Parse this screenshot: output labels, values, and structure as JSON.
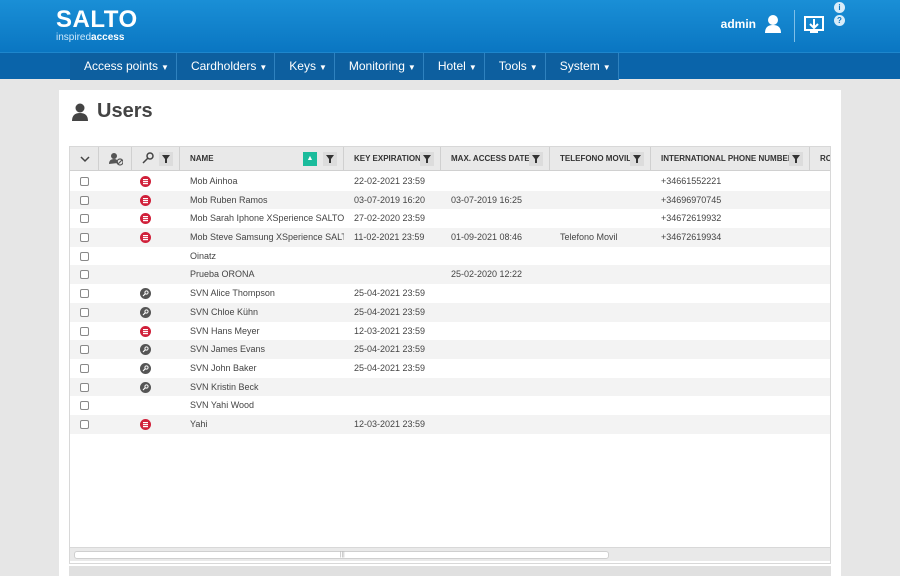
{
  "header": {
    "logo": "SALTO",
    "logo_sub_a": "inspired",
    "logo_sub_b": "access",
    "user": "admin",
    "help_1": "i",
    "help_2": "?"
  },
  "nav": [
    {
      "label": "Access points"
    },
    {
      "label": "Cardholders"
    },
    {
      "label": "Keys"
    },
    {
      "label": "Monitoring"
    },
    {
      "label": "Hotel"
    },
    {
      "label": "Tools"
    },
    {
      "label": "System"
    }
  ],
  "page": {
    "title": "Users"
  },
  "table": {
    "columns": {
      "name": "NAME",
      "key_expiration": "KEY EXPIRATION",
      "max_access_date": "MAX. ACCESS DATE",
      "telefono_movil": "TELEFONO MOVIL",
      "intl_phone": "INTERNATIONAL PHONE NUMBER",
      "extra": "ROI"
    },
    "rows": [
      {
        "icon": "mobile",
        "name": "Mob Ainhoa",
        "key_exp": "22-02-2021 23:59",
        "max_access": "",
        "tel": "",
        "intl": "+34661552221"
      },
      {
        "icon": "mobile",
        "name": "Mob Ruben Ramos",
        "key_exp": "03-07-2019 16:20",
        "max_access": "03-07-2019 16:25",
        "tel": "",
        "intl": "+34696970745"
      },
      {
        "icon": "mobile",
        "name": "Mob Sarah Iphone XSperience SALTO",
        "key_exp": "27-02-2020 23:59",
        "max_access": "",
        "tel": "",
        "intl": "+34672619932"
      },
      {
        "icon": "mobile",
        "name": "Mob Steve Samsung XSperience SALTO",
        "key_exp": "11-02-2021 23:59",
        "max_access": "01-09-2021 08:46",
        "tel": "Telefono Movil",
        "intl": "+34672619934"
      },
      {
        "icon": "none",
        "name": "Oinatz",
        "key_exp": "",
        "max_access": "",
        "tel": "",
        "intl": ""
      },
      {
        "icon": "none",
        "name": "Prueba ORONA",
        "key_exp": "",
        "max_access": "25-02-2020 12:22",
        "tel": "",
        "intl": ""
      },
      {
        "icon": "key",
        "name": "SVN Alice Thompson",
        "key_exp": "25-04-2021 23:59",
        "max_access": "",
        "tel": "",
        "intl": ""
      },
      {
        "icon": "key",
        "name": "SVN Chloe Kühn",
        "key_exp": "25-04-2021 23:59",
        "max_access": "",
        "tel": "",
        "intl": ""
      },
      {
        "icon": "mobile",
        "name": "SVN Hans Meyer",
        "key_exp": "12-03-2021 23:59",
        "max_access": "",
        "tel": "",
        "intl": ""
      },
      {
        "icon": "key",
        "name": "SVN James Evans",
        "key_exp": "25-04-2021 23:59",
        "max_access": "",
        "tel": "",
        "intl": ""
      },
      {
        "icon": "key",
        "name": "SVN John Baker",
        "key_exp": "25-04-2021 23:59",
        "max_access": "",
        "tel": "",
        "intl": ""
      },
      {
        "icon": "key",
        "name": "SVN Kristin Beck",
        "key_exp": "",
        "max_access": "",
        "tel": "",
        "intl": ""
      },
      {
        "icon": "none",
        "name": "SVN Yahi Wood",
        "key_exp": "",
        "max_access": "",
        "tel": "",
        "intl": ""
      },
      {
        "icon": "mobile",
        "name": "Yahi",
        "key_exp": "12-03-2021 23:59",
        "max_access": "",
        "tel": "",
        "intl": ""
      }
    ]
  },
  "colors": {
    "brand": "#0a76c2",
    "nav": "#0a64aa",
    "sort_active": "#1abc9c",
    "mobile_icon": "#d0203a",
    "key_icon": "#555555"
  }
}
